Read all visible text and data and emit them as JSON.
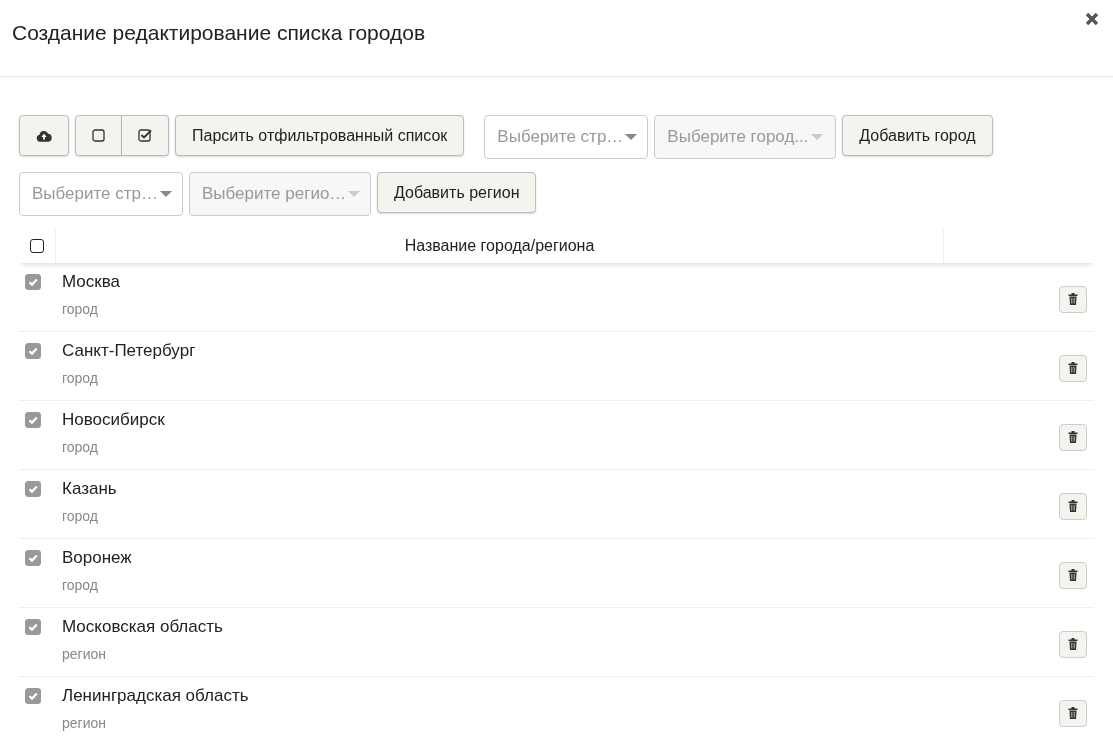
{
  "dialog": {
    "title": "Создание редактирование списка городов"
  },
  "toolbar": {
    "row_1": [
      {
        "kind": "icon"
      },
      {
        "kind": "group"
      },
      {
        "kind": "button",
        "label": "Парсить отфильтрованный список"
      },
      {
        "kind": "select",
        "placeholder": "Выберите стр…",
        "disabled": false
      },
      {
        "kind": "select",
        "placeholder": "Выберите город...",
        "disabled": true
      },
      {
        "kind": "button",
        "label": "Добавить город"
      }
    ],
    "row_2": [
      {
        "kind": "select",
        "placeholder": "Выберите стр…",
        "disabled": false
      },
      {
        "kind": "select",
        "placeholder": "Выберите регио…",
        "disabled": true
      },
      {
        "kind": "button",
        "label": "Добавить регион"
      }
    ]
  },
  "table": {
    "header_checked": false,
    "column_heading": "Название города/региона",
    "rows": [
      {
        "name": "Москва",
        "type": "город",
        "checked": true
      },
      {
        "name": "Санкт-Петербург",
        "type": "город",
        "checked": true
      },
      {
        "name": "Новосибирск",
        "type": "город",
        "checked": true
      },
      {
        "name": "Казань",
        "type": "город",
        "checked": true
      },
      {
        "name": "Воронеж",
        "type": "город",
        "checked": true
      },
      {
        "name": "Московская область",
        "type": "регион",
        "checked": true
      },
      {
        "name": "Ленинградская область",
        "type": "регион",
        "checked": true
      }
    ]
  }
}
